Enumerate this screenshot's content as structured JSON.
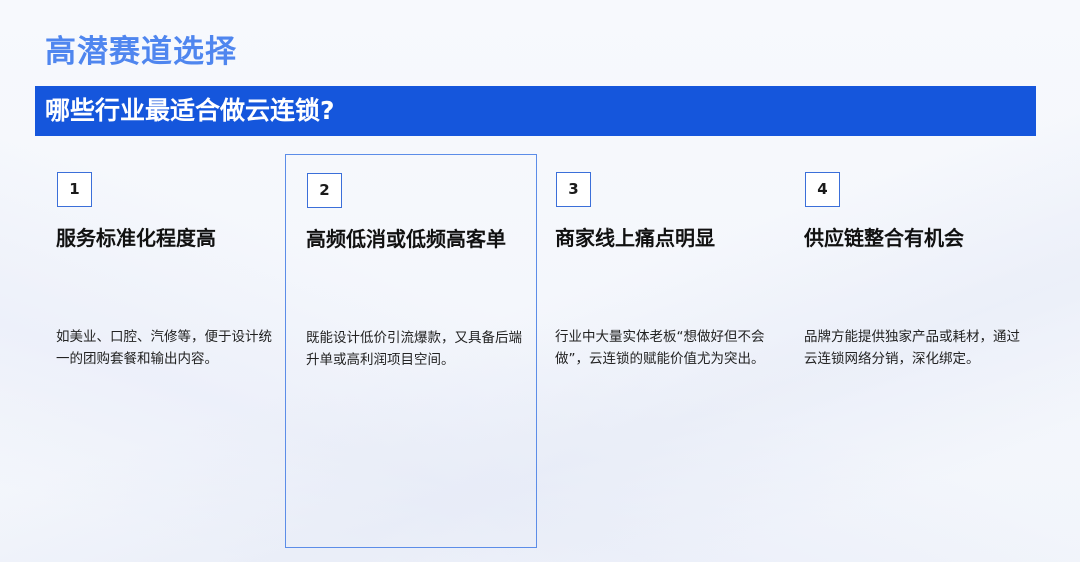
{
  "page": {
    "title": "高潜赛道选择",
    "banner": "哪些行业最适合做云连锁?"
  },
  "cards": [
    {
      "number": "1",
      "heading": "服务标准化程度高",
      "description": "如美业、口腔、汽修等，便于设计统一的团购套餐和输出内容。"
    },
    {
      "number": "2",
      "heading": "高频低消或低频高客单",
      "description": "既能设计低价引流爆款，又具备后端升单或高利润项目空间。"
    },
    {
      "number": "3",
      "heading": "商家线上痛点明显",
      "description": "行业中大量实体老板“想做好但不会做”，云连锁的赋能价值尤为突出。"
    },
    {
      "number": "4",
      "heading": "供应链整合有机会",
      "description": "品牌方能提供独家产品或耗材，通过云连锁网络分销，深化绑定。"
    }
  ],
  "colors": {
    "title": "#4f86ef",
    "banner_bg": "#1556dc",
    "banner_text": "#ffffff",
    "highlight_border": "#5c8de8",
    "number_border": "#3b6fd9"
  }
}
